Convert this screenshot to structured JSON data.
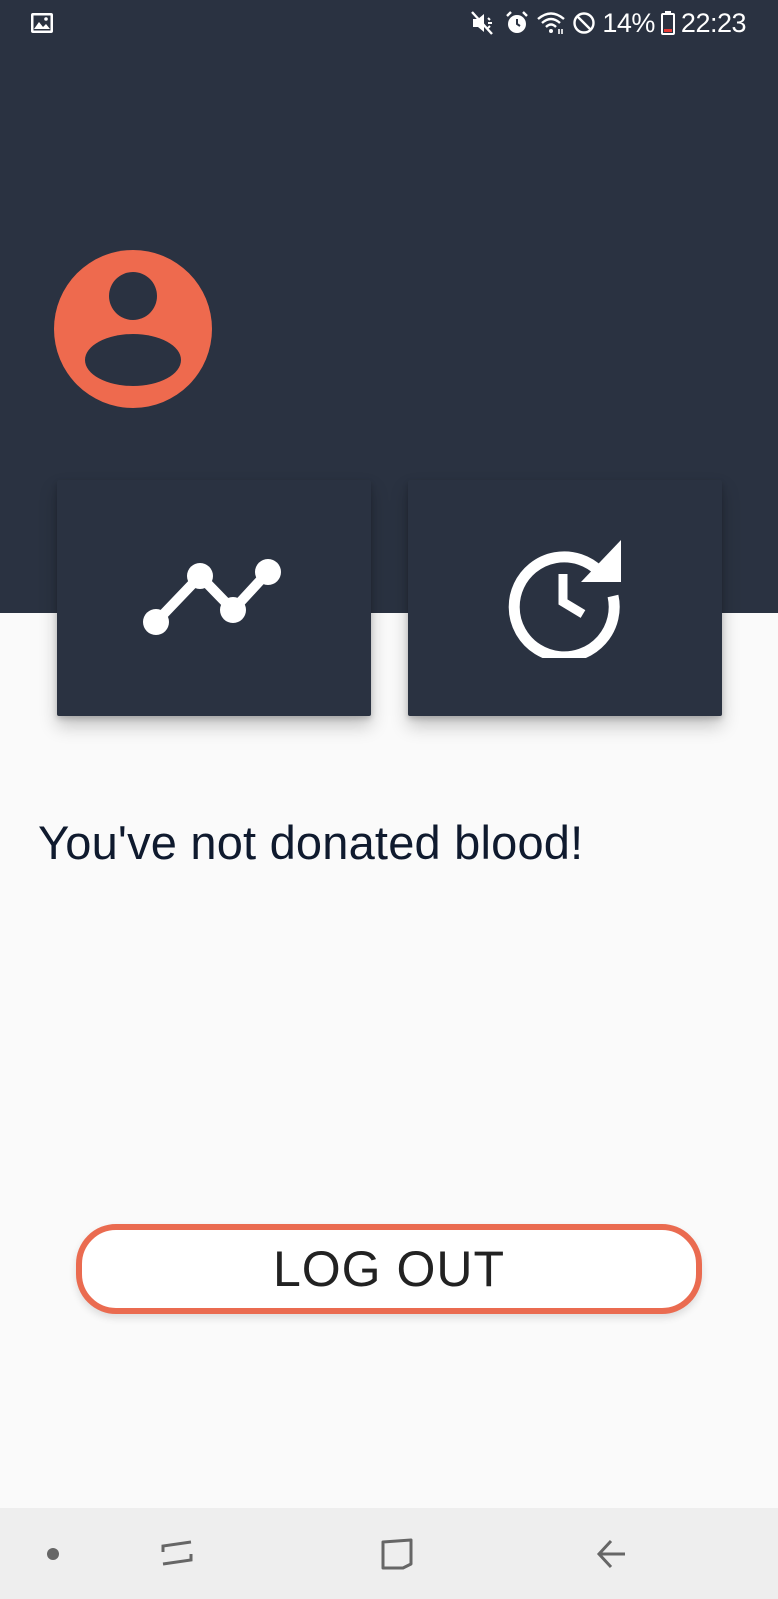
{
  "status_bar": {
    "battery_percent": "14%",
    "time": "22:23",
    "icons": [
      "gallery-icon",
      "mute-icon",
      "alarm-icon",
      "wifi-icon",
      "do-not-disturb-icon",
      "battery-icon"
    ]
  },
  "profile": {
    "avatar_icon": "account-circle-icon",
    "avatar_color": "#ee6a4e"
  },
  "cards": [
    {
      "icon": "stats-chart-icon"
    },
    {
      "icon": "history-icon"
    }
  ],
  "main": {
    "message": "You've not donated blood!"
  },
  "logout": {
    "label": "LOG OUT",
    "border_color": "#ea6b50"
  },
  "nav_bar": {
    "icons": [
      "dot-icon",
      "recent-apps-icon",
      "home-icon",
      "back-icon"
    ]
  },
  "theme": {
    "header_background": "#2a3241",
    "page_background": "#fafafa"
  }
}
